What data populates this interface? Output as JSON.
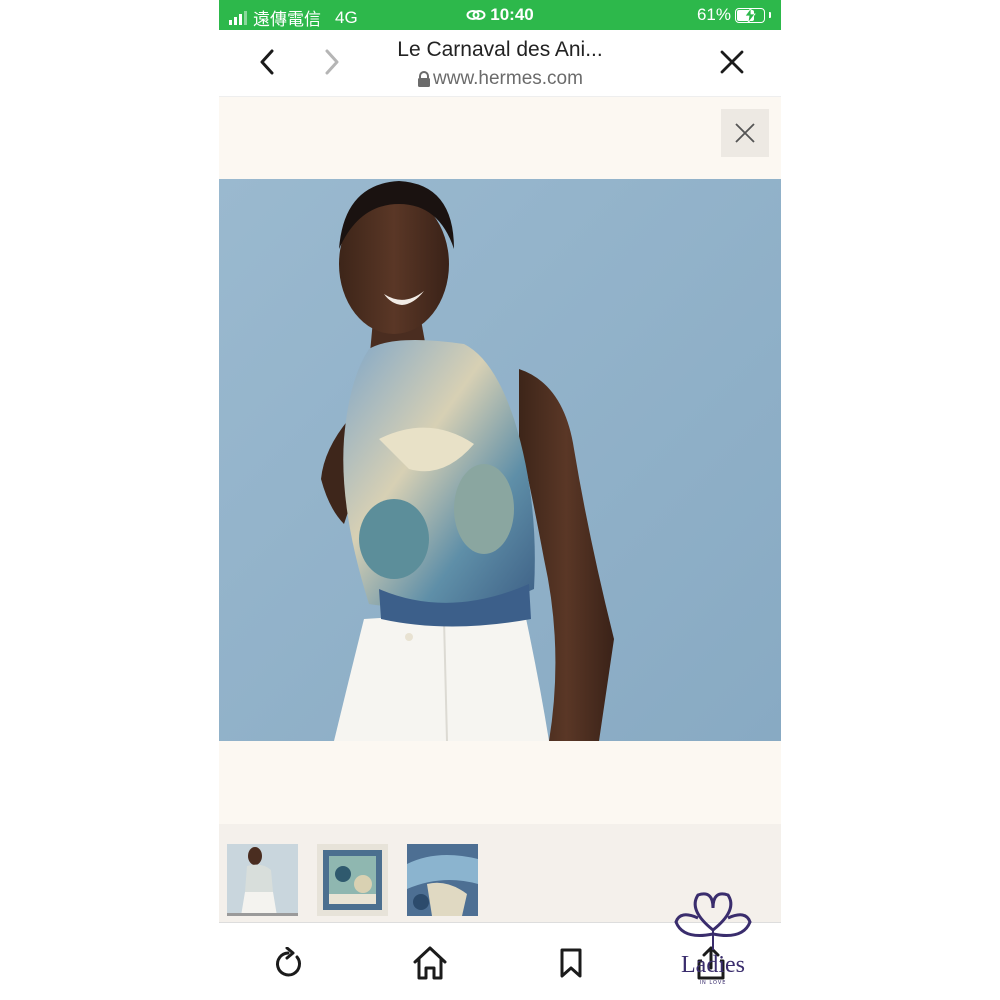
{
  "status_bar": {
    "carrier": "遠傳電信",
    "network": "4G",
    "time": "10:40",
    "battery_percent": "61%",
    "battery_level": 0.61,
    "background_color": "#2db84b"
  },
  "browser": {
    "page_title": "Le Carnaval des Ani...",
    "url": "www.hermes.com",
    "icons": {
      "back": "chevron-left-icon",
      "forward": "chevron-right-icon",
      "close": "close-icon",
      "lock": "lock-icon"
    }
  },
  "product": {
    "close_icon": "close-icon",
    "photo_background": "#95b6cf",
    "thumbnails": [
      {
        "name": "model-wearing-scarf",
        "active": true
      },
      {
        "name": "scarf-flat-square",
        "active": false
      },
      {
        "name": "scarf-detail",
        "active": false
      }
    ]
  },
  "toolbar": {
    "icons": [
      "reload-icon",
      "home-icon",
      "bookmark-icon",
      "share-icon"
    ]
  },
  "watermark": {
    "text": "Ladies",
    "subtext": "IN LOVE"
  }
}
